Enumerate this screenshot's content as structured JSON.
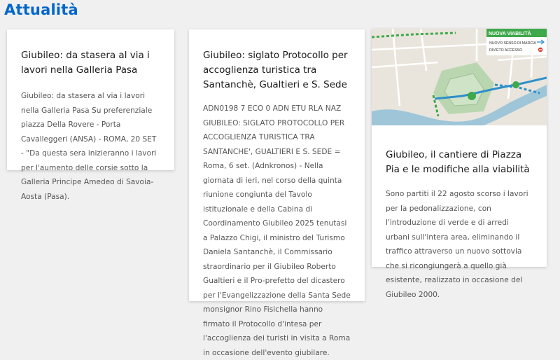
{
  "section": {
    "title": "Attualità"
  },
  "cards": [
    {
      "title": "Giubileo: da stasera al via i lavori nella Galleria Pasa",
      "text": "Giubileo: da stasera al via i lavori nella Galleria Pasa Su preferenziale piazza Della Rovere - Porta Cavalleggeri (ANSA) - ROMA, 20 SET - \"Da questa sera inizieranno i lavori per l'aumento delle corsie sotto la Galleria Principe Amedeo di Savoia-Aosta (Pasa)."
    },
    {
      "title": "Giubileo: siglato Protocollo per accoglienza turistica tra Santanchè, Gualtieri e S. Sede",
      "text": "ADN0198 7 ECO 0 ADN ETU RLA NAZ GIUBILEO: SIGLATO PROTOCOLLO PER ACCOGLIENZA TURISTICA TRA SANTANCHE', GUALTIERI E S. SEDE = Roma, 6 set. (Adnkronos) - Nella giornata di ieri, nel corso della quinta riunione congiunta del Tavolo istituzionale e della Cabina di Coordinamento Giubileo 2025 tenutasi a Palazzo Chigi, il ministro del Turismo Daniela Santanchè, il Commissario straordinario per il Giubileo Roberto Gualtieri e il Pro-prefetto del dicastero per l'Evangelizzazione della Santa Sede monsignor Rino Fisichella hanno firmato il Protocollo d'intesa per l'accoglienza dei turisti in visita a Roma in occasione dell'evento giubilare."
    },
    {
      "title": "Giubileo, il cantiere di Piazza Pia e le modifiche alla viabilità",
      "text": "Sono partiti il 22 agosto scorso i lavori per la pedonalizzazione, con l'introduzione di verde e di arredi urbani sull'intera area, eliminando il traffico attraverso un nuovo sottovia che si ricongiungerà a quello già esistente, realizzato in occasione del Giubileo 2000.",
      "map": {
        "legend_title": "NUOVA VIABILITÀ",
        "legend_items": [
          "NUOVO SENSO DI MARCIA",
          "DIVIETO ACCESSO"
        ]
      }
    }
  ],
  "colors": {
    "accent": "#0066cc",
    "background": "#f0f0f0"
  }
}
